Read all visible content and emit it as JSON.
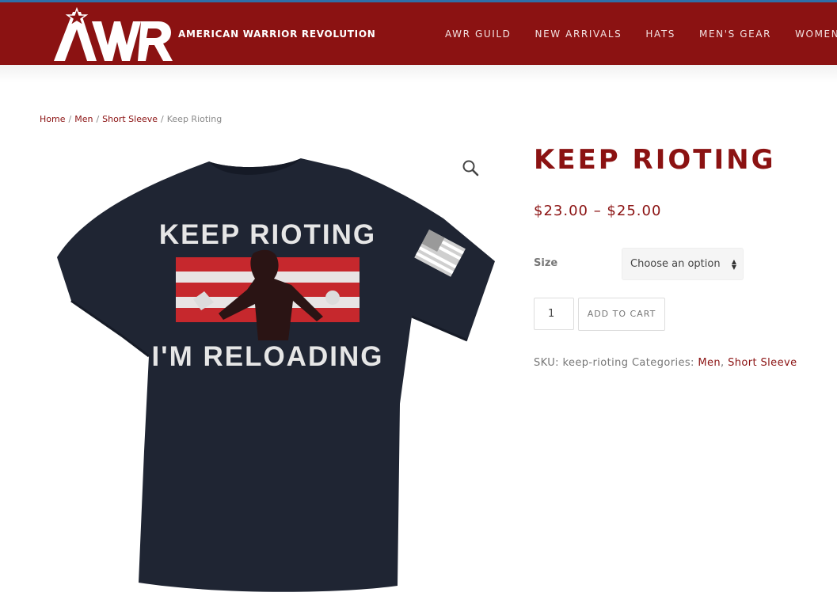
{
  "header": {
    "logo_text": "AWR",
    "tagline": "AMERICAN WARRIOR REVOLUTION",
    "nav": [
      "AWR GUILD",
      "NEW ARRIVALS",
      "HATS",
      "MEN'S GEAR",
      "WOMEN'S"
    ]
  },
  "breadcrumb": {
    "items": [
      "Home",
      "Men",
      "Short Sleeve"
    ],
    "current": "Keep Rioting"
  },
  "product": {
    "title": "KEEP RIOTING",
    "price_range": "$23.00 – $25.00",
    "size_label": "Size",
    "size_select": "Choose an option",
    "quantity": "1",
    "add_to_cart": "ADD TO CART",
    "sku_label": "SKU:",
    "sku": "keep-rioting",
    "categories_label": "Categories:",
    "categories": [
      "Men",
      "Short Sleeve"
    ],
    "image": {
      "text_top": "KEEP RIOTING",
      "text_bottom": "I'M RELOADING"
    }
  },
  "colors": {
    "brand": "#8b1212",
    "shirt": "#1f2533",
    "flag_red": "#c6282d"
  },
  "icons": {
    "zoom": "magnifier-icon"
  }
}
